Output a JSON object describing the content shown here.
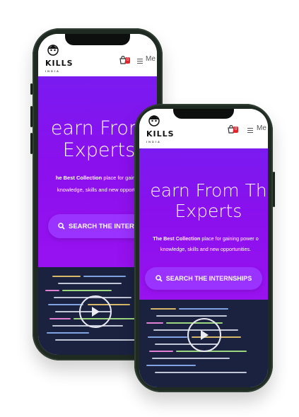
{
  "brand": {
    "logo_text": "KILLS",
    "logo_front_text": "KILLS",
    "logo_sub": "INDIA"
  },
  "header": {
    "cart_count": "0",
    "menu_label_back": "Me",
    "menu_label_front": "Me"
  },
  "hero": {
    "title_line1_back": "earn From",
    "title_line2_back": "Experts",
    "title_line1_front": "earn From Th",
    "title_line2_front": "Experts",
    "subtitle_strong_back": "he Best Collection",
    "subtitle_rest_back": " place for gainin",
    "subtitle_line2_back": "knowledge, skills and new opportu",
    "subtitle_strong_front": "The Best Collection",
    "subtitle_rest_front": " place for gaining power o",
    "subtitle_line2_front": "knowledge, skills and new opportunities.",
    "cta_label_back": "SEARCH THE INTERNSH",
    "cta_label_front": "SEARCH THE INTERNSHIPS"
  },
  "colors": {
    "hero_purple": "#8a10ee",
    "cta": "#9a33ff",
    "badge": "#e5232b",
    "phone_frame": "#1f2a22"
  }
}
